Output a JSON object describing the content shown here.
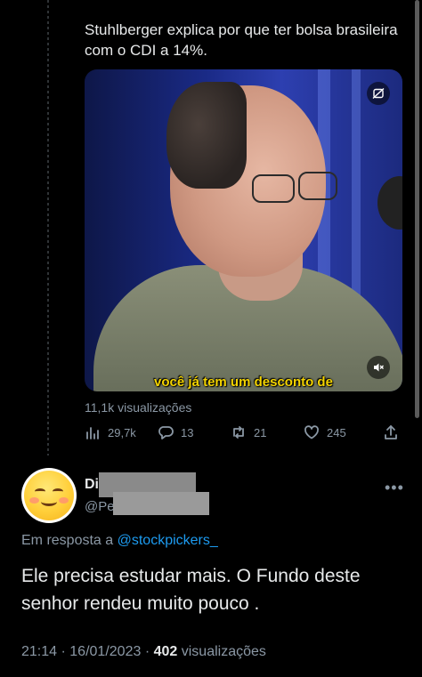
{
  "quoted": {
    "text": "Stuhlberger explica por que ter bolsa brasileira com o CDI a 14%.",
    "video": {
      "caption": "você já tem um desconto de",
      "top_right_icon": "no-media-icon",
      "bottom_right_icon": "muted-speaker-icon"
    },
    "views": "11,1k visualizações",
    "actions": {
      "analytics_count": "29,7k",
      "reply_count": "13",
      "retweet_count": "21",
      "like_count": "245"
    }
  },
  "reply": {
    "name_prefix": "Di",
    "handle_prefix": "@Pe",
    "more_label": "•••",
    "reply_to_label": "Em resposta a",
    "reply_to_mention": "@stockpickers_",
    "text": "Ele precisa estudar mais. O Fundo deste senhor rendeu muito pouco .",
    "time": "21:14",
    "separator": "·",
    "date": "16/01/2023",
    "views_count": "402",
    "views_label": "visualizações"
  },
  "colors": {
    "background": "#000000",
    "text": "#e7e9ea",
    "muted": "#8b98a5",
    "link": "#1d9bf0",
    "caption": "#f4d400"
  }
}
